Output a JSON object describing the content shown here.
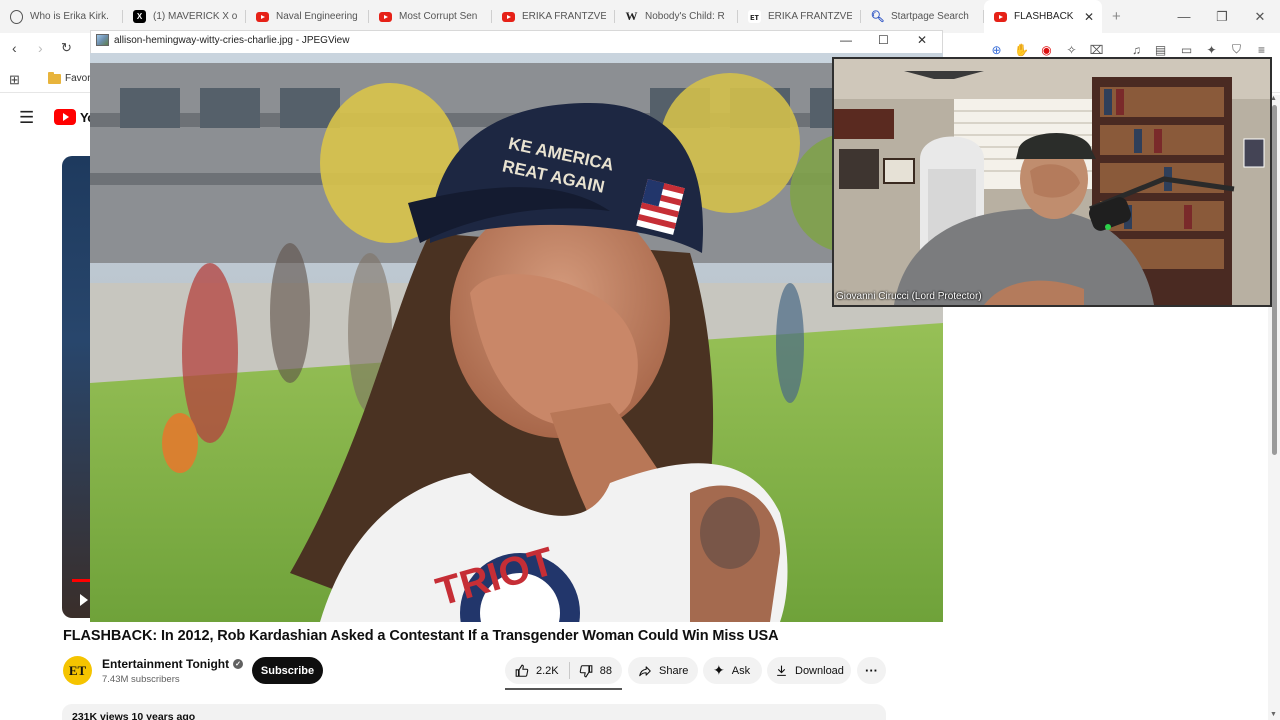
{
  "browser": {
    "tabs": [
      {
        "label": "Who is Erika Kirk.",
        "icon": "browser-icon"
      },
      {
        "label": "(1) MAVERICK X o",
        "icon": "x-icon"
      },
      {
        "label": "Naval Engineering",
        "icon": "youtube-icon"
      },
      {
        "label": "Most Corrupt Sen",
        "icon": "youtube-icon"
      },
      {
        "label": "ERIKA FRANTZVE",
        "icon": "youtube-icon"
      },
      {
        "label": "Nobody's Child: R",
        "icon": "wikipedia-icon"
      },
      {
        "label": "ERIKA FRANTZVE",
        "icon": "et-icon"
      },
      {
        "label": "Startpage Search",
        "icon": "startpage-icon"
      },
      {
        "label": "FLASHBACK: I",
        "icon": "youtube-icon",
        "active": true
      }
    ],
    "new_tab_symbol": "+",
    "tab_close_symbol": "✕",
    "bookmark_folder": "Favor"
  },
  "youtube": {
    "logo_text": "Yo",
    "video_title": "FLASHBACK: In 2012, Rob Kardashian Asked a Contestant If a Transgender Woman Could Win Miss USA",
    "channel": {
      "avatar_text": "ET",
      "name": "Entertainment Tonight",
      "subscribers": "7.43M subscribers",
      "subscribe_label": "Subscribe"
    },
    "actions": {
      "likes": "2.2K",
      "dislikes": "88",
      "share": "Share",
      "ask": "Ask",
      "download": "Download",
      "more": "···"
    },
    "description_meta": "231K views  10 years ago"
  },
  "image_viewer": {
    "title": "allison-hemingway-witty-cries-charlie.jpg - JPEGView",
    "minimize": "—",
    "maximize": "☐",
    "close": "✕",
    "photo": {
      "cap_text_line1": "KE AMERICA",
      "cap_text_line2": "REAT AGAIN",
      "shirt_text": "TRIOT"
    }
  },
  "webcam": {
    "label": "Giovanni Cirucci (Lord Protector)"
  },
  "colors": {
    "youtube_red": "#ff0000",
    "subscribe_bg": "#0f0f0f",
    "pill_bg": "#f2f2f2"
  }
}
